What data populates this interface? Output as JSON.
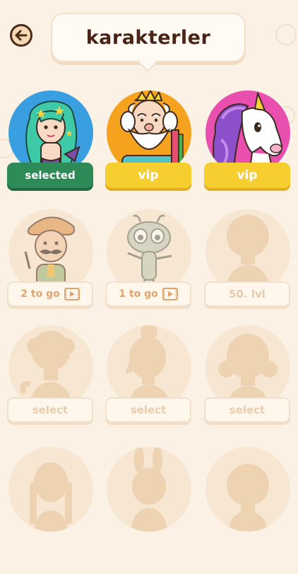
{
  "header": {
    "title": "karakterler"
  },
  "characters": [
    {
      "button_label": "selected",
      "state": "selected",
      "bg_color": "#3A9FE0"
    },
    {
      "button_label": "vip",
      "state": "vip",
      "bg_color": "#F5A21E"
    },
    {
      "button_label": "vip",
      "state": "vip",
      "bg_color": "#E84FAE"
    },
    {
      "button_label": "2 to go",
      "state": "video",
      "bg_color": "#F7E6D2"
    },
    {
      "button_label": "1 to go",
      "state": "video",
      "bg_color": "#F7E6D2"
    },
    {
      "button_label": "50. lvl",
      "state": "level",
      "bg_color": "#F7E6D2"
    },
    {
      "button_label": "select",
      "state": "locked",
      "bg_color": "#F7E6D2"
    },
    {
      "button_label": "select",
      "state": "locked",
      "bg_color": "#F7E6D2"
    },
    {
      "button_label": "select",
      "state": "locked",
      "bg_color": "#F7E6D2"
    },
    {
      "button_label": "",
      "state": "locked",
      "bg_color": "#F7E6D2"
    },
    {
      "button_label": "",
      "state": "locked",
      "bg_color": "#F7E6D2"
    },
    {
      "button_label": "",
      "state": "locked",
      "bg_color": "#F7E6D2"
    }
  ],
  "colors": {
    "accent_green": "#2E8A57",
    "vip_yellow": "#F7CE2F",
    "silhouette": "#EDD3B2",
    "text_brown": "#4A2416"
  },
  "icons": {
    "back": "arrow-left-icon",
    "video": "video-play-icon"
  }
}
